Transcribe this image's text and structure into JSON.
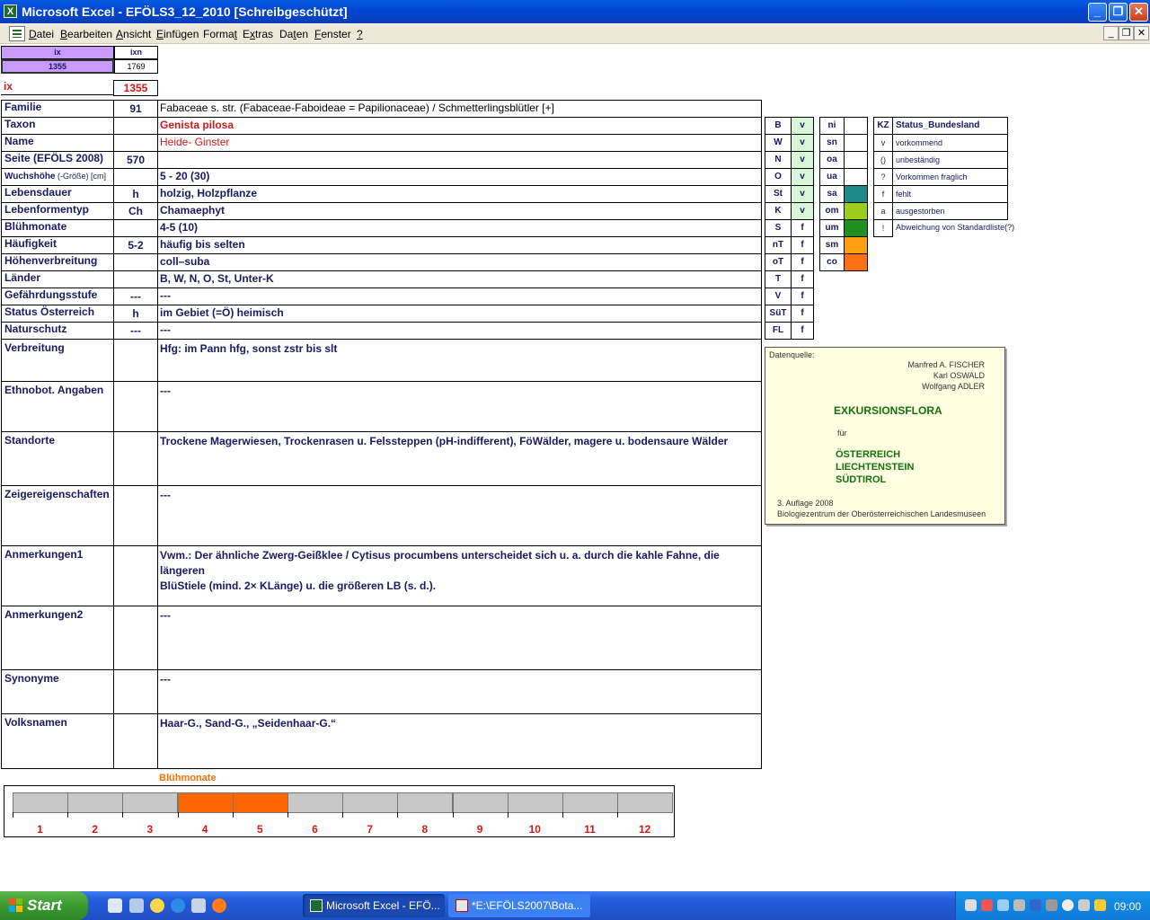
{
  "window": {
    "title": "Microsoft Excel - EFÖLS3_12_2010  [Schreibgeschützt]",
    "app_icon": "X"
  },
  "menu": [
    {
      "pre": "",
      "u": "D",
      "post": "atei"
    },
    {
      "pre": "",
      "u": "B",
      "post": "earbeiten"
    },
    {
      "pre": "",
      "u": "A",
      "post": "nsicht"
    },
    {
      "pre": "",
      "u": "E",
      "post": "infügen"
    },
    {
      "pre": "Forma",
      "u": "t",
      "post": ""
    },
    {
      "pre": "E",
      "u": "x",
      "post": "tras"
    },
    {
      "pre": "Da",
      "u": "t",
      "post": "en"
    },
    {
      "pre": "",
      "u": "F",
      "post": "enster"
    },
    {
      "pre": "",
      "u": "?",
      "post": ""
    }
  ],
  "top_cells": {
    "h1": "ix",
    "h2": "ixn",
    "v1": "1355",
    "v2": "1769",
    "ix_label": "ix",
    "ix_value": "1355"
  },
  "rows": [
    {
      "label": "Familie",
      "code": "91",
      "value": "Fabaceae s. str. (Fabaceae-Faboideae = Papilionaceae)  /  Schmetterlingsblütler [+]",
      "style": "norm"
    },
    {
      "label": "Taxon",
      "code": "",
      "value": "Genista pilosa",
      "style": "redbold"
    },
    {
      "label": "Name",
      "code": "",
      "value": "Heide- Ginster",
      "style": "red"
    },
    {
      "label": "Seite (EFÖLS 2008)",
      "code": "570",
      "value": "",
      "style": "bold"
    },
    {
      "label": "Wuchshöhe",
      "label_small": " (-Größe) [cm]",
      "code": "",
      "value": " 5 - 20 (30)",
      "style": "bold"
    },
    {
      "label": "Lebensdauer",
      "code": "h",
      "value": "holzig, Holzpflanze",
      "style": "bold"
    },
    {
      "label": "Lebenformentyp",
      "code": "Ch",
      "value": "Chamaephyt",
      "style": "bold"
    },
    {
      "label": "Blühmonate",
      "code": "",
      "value": " 4-5 (10)",
      "style": "bold"
    },
    {
      "label": "Häufigkeit",
      "code": "5-2",
      "value": "häufig bis selten",
      "style": "bold"
    },
    {
      "label": "Höhenverbreitung",
      "code": "",
      "value": "coll–suba",
      "style": "bold"
    },
    {
      "label": "Länder",
      "code": "",
      "value": "B, W, N, O, St, Unter-K",
      "style": "bold"
    },
    {
      "label": "Gefährdungsstufe",
      "code": "---",
      "value": "   ---",
      "style": "bold"
    },
    {
      "label": "Status Österreich",
      "code": "h",
      "value": "im Gebiet (=Ö) heimisch",
      "style": "bold"
    },
    {
      "label": "Naturschutz",
      "code": "---",
      "value": "---",
      "style": "bold"
    }
  ],
  "big_rows": [
    {
      "label": "Verbreitung",
      "value": "Hfg: im Pann hfg, sonst zstr bis slt"
    },
    {
      "label": "Ethnobot. Angaben",
      "value": "---"
    },
    {
      "label": "Standorte",
      "value": "Trockene Magerwiesen, Trockenrasen u. Felssteppen (pH-indifferent), FöWälder, magere u. bodensaure Wälder"
    },
    {
      "label": "Zeigereigenschaften",
      "value": "---"
    },
    {
      "label": "Anmerkungen1",
      "value": "Vwm.: Der ähnliche Zwerg-Geißklee / Cytisus procumbens unterscheidet sich u. a. durch die kahle Fahne, die längeren",
      "value2": "BlüStiele (mind. 2× KLänge) u. die größeren LB (s. d.)."
    },
    {
      "label": "Anmerkungen2",
      "value": "---"
    },
    {
      "label": "Synonyme",
      "value": "---"
    },
    {
      "label": "Volksnamen",
      "value": "Haar-G., Sand-G., „Seidenhaar-G.“"
    }
  ],
  "states": [
    {
      "k": "B",
      "v": "v"
    },
    {
      "k": "W",
      "v": "v"
    },
    {
      "k": "N",
      "v": "v"
    },
    {
      "k": "O",
      "v": "v"
    },
    {
      "k": "St",
      "v": "v"
    },
    {
      "k": "K",
      "v": "v"
    },
    {
      "k": "S",
      "v": "f"
    },
    {
      "k": "nT",
      "v": "f"
    },
    {
      "k": "oT",
      "v": "f"
    },
    {
      "k": "T",
      "v": "f"
    },
    {
      "k": "V",
      "v": "f"
    },
    {
      "k": "SüT",
      "v": "f"
    },
    {
      "k": "FL",
      "v": "f"
    }
  ],
  "zones": [
    {
      "k": "ni",
      "color": ""
    },
    {
      "k": "sn",
      "color": ""
    },
    {
      "k": "oa",
      "color": ""
    },
    {
      "k": "ua",
      "color": ""
    },
    {
      "k": "sa",
      "color": "#1e8a8a"
    },
    {
      "k": "om",
      "color": "#9acd1e"
    },
    {
      "k": "um",
      "color": "#1f8f1f"
    },
    {
      "k": "sm",
      "color": "#ffa010"
    },
    {
      "k": "co",
      "color": "#ff7010"
    }
  ],
  "legend": {
    "header_kz": "KZ",
    "header_status": "Status_Bundesland",
    "items": [
      {
        "k": "v",
        "t": "vorkommend"
      },
      {
        "k": "()",
        "t": "unbeständig"
      },
      {
        "k": "?",
        "t": "Vorkommen fraglich"
      },
      {
        "k": "f",
        "t": "fehlt"
      },
      {
        "k": "a",
        "t": "ausgestorben"
      },
      {
        "k": "!",
        "t": "Abweichung von Standardliste(?)"
      }
    ]
  },
  "source": {
    "heading": "Datenquelle:",
    "authors": [
      "Manfred A. FISCHER",
      "Karl OSWALD",
      "Wolfgang ADLER"
    ],
    "title": "EXKURSIONSFLORA",
    "fuer": "für",
    "countries": [
      "ÖSTERREICH",
      "LIECHTENSTEIN",
      "SÜDTIROL"
    ],
    "edition": "3. Auflage 2008",
    "publisher": "Biologiezentrum der Oberösterreichischen Landesmuseen"
  },
  "bluete": {
    "title": "Blühmonate",
    "months": [
      "1",
      "2",
      "3",
      "4",
      "5",
      "6",
      "7",
      "8",
      "9",
      "10",
      "11",
      "12"
    ],
    "active": [
      4,
      5
    ],
    "active_color": "#ff6600",
    "inactive_color": "#c8c8c8"
  },
  "taskbar": {
    "start": "Start",
    "tasks": [
      {
        "label": "Microsoft Excel - EFÖ...",
        "icon": "excel-icon"
      },
      {
        "label": "*E:\\EFÖLS2007\\Bota...",
        "icon": "document-icon"
      }
    ],
    "clock": "09:00"
  }
}
